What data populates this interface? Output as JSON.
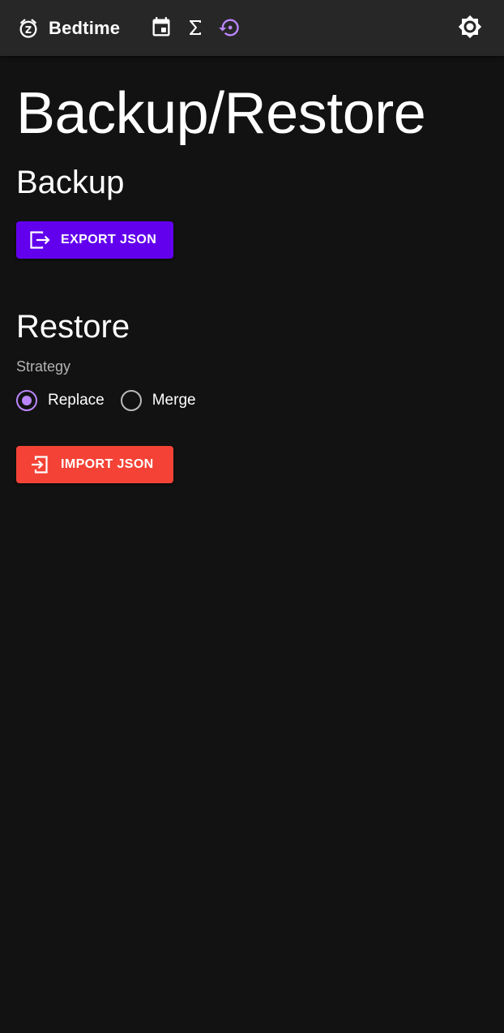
{
  "appbar": {
    "title": "Bedtime",
    "brand_icon": "alarm-snooze-icon",
    "nav_icons": [
      "calendar-icon",
      "sigma-icon",
      "restore-icon"
    ],
    "active_icon": "restore-icon",
    "theme_icon": "brightness-icon"
  },
  "page": {
    "title": "Backup/Restore"
  },
  "backup": {
    "heading": "Backup",
    "export_label": "EXPORT JSON",
    "export_icon": "export-icon"
  },
  "restore": {
    "heading": "Restore",
    "strategy_label": "Strategy",
    "options": [
      "Replace",
      "Merge"
    ],
    "selected": "Replace",
    "import_label": "IMPORT JSON",
    "import_icon": "import-icon"
  },
  "colors": {
    "background": "#121212",
    "appbar": "#272727",
    "accent": "#bb86fc",
    "primary": "#6200ee",
    "danger": "#f44336"
  }
}
